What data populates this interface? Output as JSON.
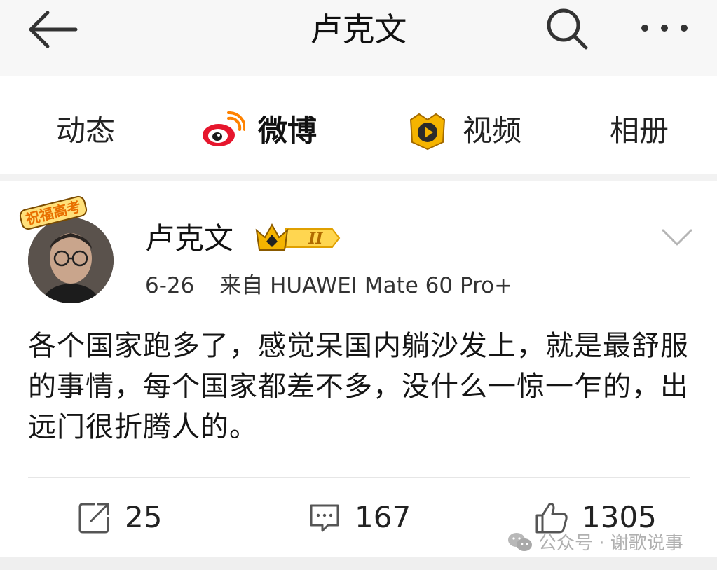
{
  "header": {
    "title": "卢克文",
    "icons": {
      "back": "back-arrow-icon",
      "search": "search-icon",
      "more": "more-icon"
    }
  },
  "tabs": [
    {
      "label": "动态",
      "active": false
    },
    {
      "label": "微博",
      "active": true,
      "icon": "weibo-logo-icon"
    },
    {
      "label": "视频",
      "active": false,
      "icon": "video-play-icon"
    },
    {
      "label": "相册",
      "active": false
    }
  ],
  "post": {
    "avatar_badge": "祝福高考",
    "username": "卢克文",
    "vip_level": "II",
    "date": "6-26",
    "source": "来自 HUAWEI Mate 60 Pro+",
    "content": "各个国家跑多了，感觉呆国内躺沙发上，就是最舒服的事情，每个国家都差不多，没什么一惊一乍的，出远门很折腾人的。",
    "actions": {
      "repost_count": "25",
      "comment_count": "167",
      "like_count": "1305"
    }
  },
  "watermark": "公众号 · 谢歌说事",
  "colors": {
    "accent": "#ff8200",
    "weibo_red": "#e6162d",
    "vip_gold": "#f5b400"
  }
}
